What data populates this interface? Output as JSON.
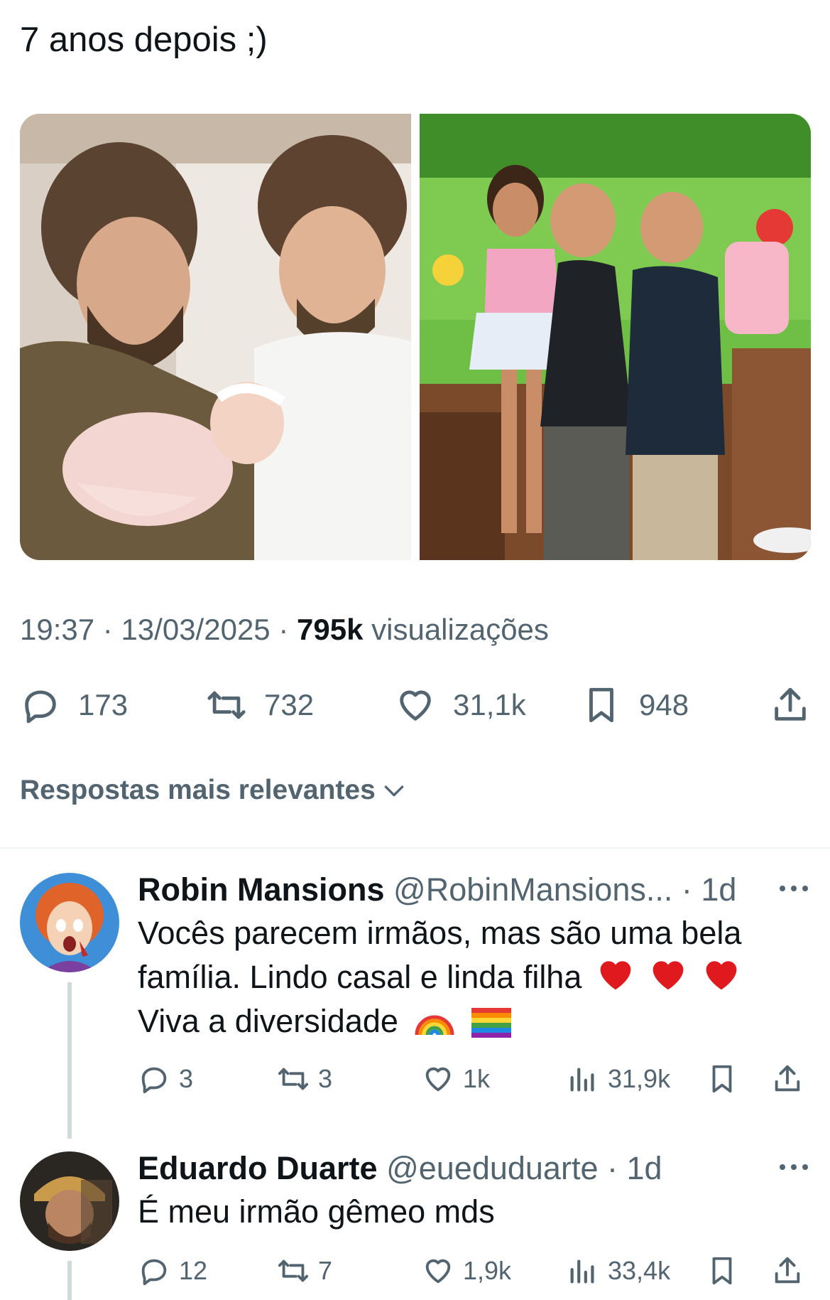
{
  "tweet": {
    "text": "7 anos depois ;)",
    "time": "19:37",
    "date": "13/03/2025",
    "views_count": "795k",
    "views_label": "visualizações",
    "separator": "·"
  },
  "actions": {
    "replies": "173",
    "retweets": "732",
    "likes": "31,1k",
    "bookmarks": "948"
  },
  "sort": {
    "label": "Respostas mais relevantes"
  },
  "replies": [
    {
      "name": "Robin Mansions",
      "handle": "@RobinMansions...",
      "time": "1d",
      "line1": "Vocês parecem irmãos, mas são uma bela",
      "line2": "família. Lindo casal e linda filha",
      "line3": "Viva a diversidade",
      "replies": "3",
      "retweets": "3",
      "likes": "1k",
      "views": "31,9k"
    },
    {
      "name": "Eduardo Duarte",
      "handle": "@eueduduarte",
      "time": "1d",
      "line1": "É meu irmão gêmeo mds",
      "replies": "12",
      "retweets": "7",
      "likes": "1,9k",
      "views": "33,4k"
    }
  ],
  "icons": {
    "reply": "reply-icon",
    "retweet": "retweet-icon",
    "like": "heart-icon",
    "bookmark": "bookmark-icon",
    "share": "share-icon",
    "views": "views-icon",
    "more": "more-icon",
    "chevron": "chevron-down-icon"
  },
  "colors": {
    "text": "#0f1419",
    "secondary": "#536471",
    "divider": "#eff3f4",
    "thread": "#cfd9de"
  }
}
